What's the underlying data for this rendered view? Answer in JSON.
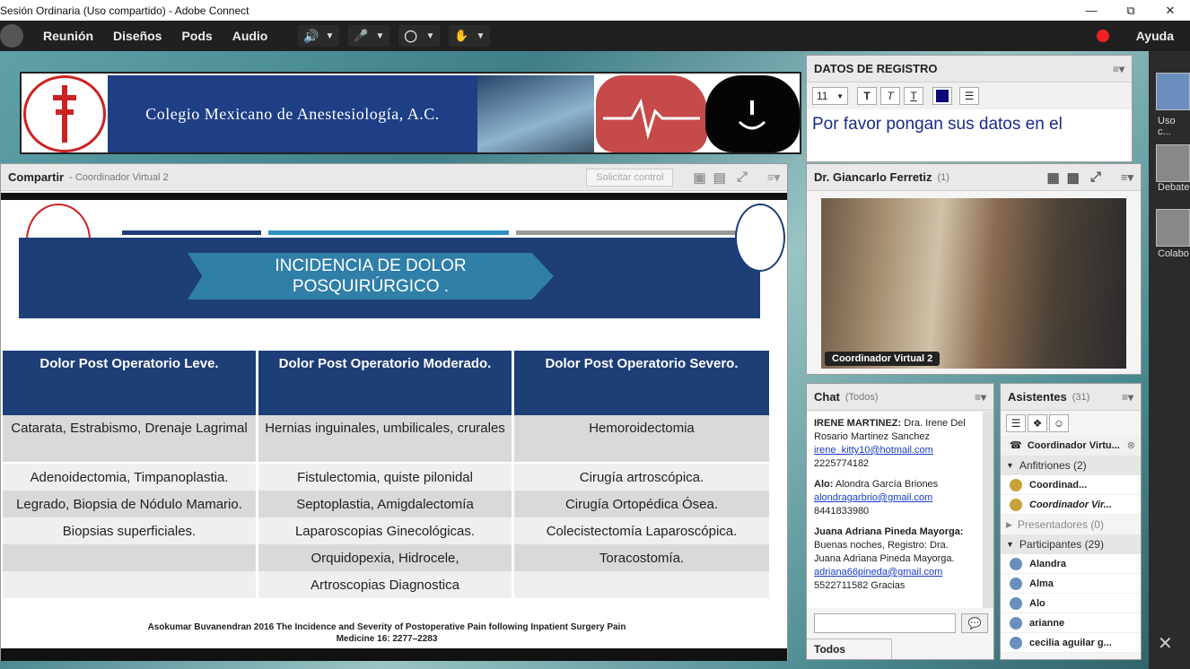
{
  "window": {
    "title": "Sesión Ordinaria (Uso compartido) - Adobe Connect"
  },
  "menu": {
    "items": [
      "Reunión",
      "Diseños",
      "Pods",
      "Audio"
    ],
    "help": "Ayuda"
  },
  "banner": {
    "title": "Colegio Mexicano de Anestesiología, A.C."
  },
  "share": {
    "title": "Compartir",
    "presenter": "- Coordinador Virtual 2",
    "request_control": "Solicitar control",
    "slide": {
      "heading_line1": "INCIDENCIA  DE DOLOR",
      "heading_line2": "POSQUIRÚRGICO .",
      "columns": [
        "Dolor Post Operatorio Leve.",
        "Dolor Post Operatorio Moderado.",
        "Dolor Post Operatorio Severo."
      ],
      "rows": [
        [
          "Catarata, Estrabismo, Drenaje Lagrimal",
          "Hernias inguinales, umbilicales, crurales",
          "Hemoroidectomia"
        ],
        [
          "Adenoidectomia, Timpanoplastia.",
          "Fistulectomia, quiste pilonidal",
          "Cirugía artroscópica."
        ],
        [
          "Legrado, Biopsia de Nódulo Mamario.",
          "Septoplastia, Amigdalectomía",
          "Cirugía Ortopédica Ósea."
        ],
        [
          "Biopsias superficiales.",
          "Laparoscopias Ginecológicas.",
          "Colecistectomía Laparoscópica."
        ],
        [
          "",
          "Orquidopexia, Hidrocele,",
          "Toracostomía."
        ],
        [
          "",
          "Artroscopias Diagnostica",
          ""
        ]
      ],
      "reference_line1": "Asokumar Buvanendran 2016 The Incidence and Severity of Postoperative Pain following Inpatient Surgery Pain",
      "reference_line2": "Medicine 16: 2277–2283"
    }
  },
  "registro": {
    "title": "DATOS DE REGISTRO",
    "font_size": "11",
    "text": "Por favor pongan sus datos en el"
  },
  "camera": {
    "title": "Dr. Giancarlo Ferretiz",
    "count": "(1)",
    "video_label": "Coordinador Virtual 2"
  },
  "chat": {
    "title": "Chat",
    "scope": "(Todos)",
    "footer": "Todos",
    "messages": [
      {
        "sender": "IRENE MARTINEZ:",
        "text": "Dra. Irene Del Rosario Martinez Sanchez",
        "email": "irene_kitty10@hotmail.com",
        "phone": "2225774182"
      },
      {
        "sender": "Alo:",
        "text": "Alondra García Briones",
        "email": "alondragarbrio@gmail.com",
        "phone": "8441833980"
      },
      {
        "sender": "Juana Adriana Pineda Mayorga:",
        "text": "Buenas noches, Registro: Dra. Juana Adriana Pineda Mayorga.",
        "email": "adriana66pineda@gmail.com",
        "phone": "5522711582 Gracias"
      }
    ]
  },
  "attendees": {
    "title": "Asistentes",
    "count": "(31)",
    "current": "Coordinador Virtu...",
    "hosts_label": "Anfitriones (2)",
    "hosts": [
      "Coordinad...",
      "Coordinador Vir..."
    ],
    "presenters_label": "Presentadores (0)",
    "participants_label": "Participantes (29)",
    "participants": [
      "Alandra",
      "Alma",
      "Alo",
      "arianne",
      "cecilia aguilar g..."
    ]
  },
  "layouts": {
    "items": [
      "Uso c...",
      "Debate",
      "Colabo"
    ]
  }
}
